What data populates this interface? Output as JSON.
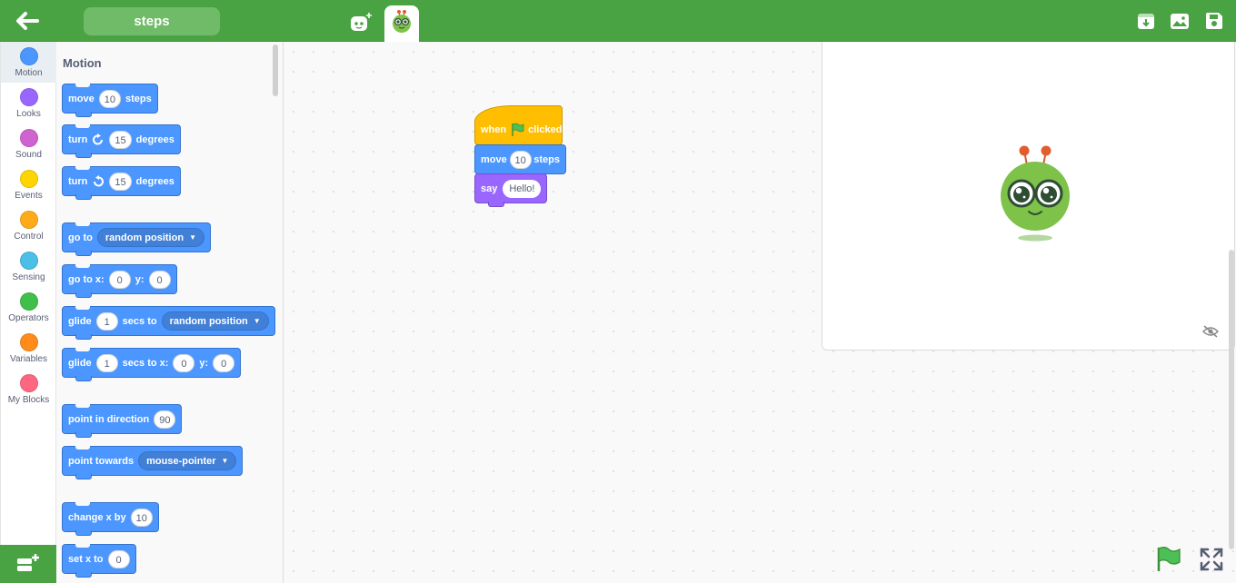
{
  "header": {
    "project_title": "steps",
    "icons": [
      "back-arrow-icon",
      "add-sprite-icon",
      "sprite-tab-icon",
      "save-to-computer-icon",
      "backdrop-icon",
      "save-icon"
    ]
  },
  "categories": [
    {
      "label": "Motion",
      "color": "#4c97ff",
      "active": true
    },
    {
      "label": "Looks",
      "color": "#9966ff"
    },
    {
      "label": "Sound",
      "color": "#cf63cf"
    },
    {
      "label": "Events",
      "color": "#ffd500"
    },
    {
      "label": "Control",
      "color": "#ffab19"
    },
    {
      "label": "Sensing",
      "color": "#4cbfe6"
    },
    {
      "label": "Operators",
      "color": "#40bf4a"
    },
    {
      "label": "Variables",
      "color": "#ff8c1a"
    },
    {
      "label": "My Blocks",
      "color": "#ff6680"
    }
  ],
  "palette": {
    "title": "Motion",
    "move": {
      "a": "move",
      "n": "10",
      "b": "steps"
    },
    "turn_cw": {
      "a": "turn",
      "n": "15",
      "b": "degrees"
    },
    "turn_ccw": {
      "a": "turn",
      "n": "15",
      "b": "degrees"
    },
    "goto": {
      "a": "go to",
      "dd": "random position"
    },
    "gotoxy": {
      "a": "go to x:",
      "x": "0",
      "ylbl": "y:",
      "y": "0"
    },
    "glide": {
      "a": "glide",
      "n": "1",
      "b": "secs to",
      "dd": "random position"
    },
    "glidexy": {
      "a": "glide",
      "n": "1",
      "b": "secs to x:",
      "x": "0",
      "ylbl": "y:",
      "y": "0"
    },
    "point_dir": {
      "a": "point in direction",
      "n": "90"
    },
    "point_towards": {
      "a": "point towards",
      "dd": "mouse-pointer"
    },
    "change_x": {
      "a": "change x by",
      "n": "10"
    },
    "set_x": {
      "a": "set x to",
      "n": "0"
    }
  },
  "script": {
    "hat": {
      "a": "when",
      "b": "clicked"
    },
    "move": {
      "a": "move",
      "n": "10",
      "b": "steps"
    },
    "say": {
      "a": "say",
      "text": "Hello!"
    }
  },
  "colors": {
    "topbar": "#4aa343",
    "motion": "#4c97ff",
    "looks": "#9966ff",
    "events": "#ffbf00"
  }
}
